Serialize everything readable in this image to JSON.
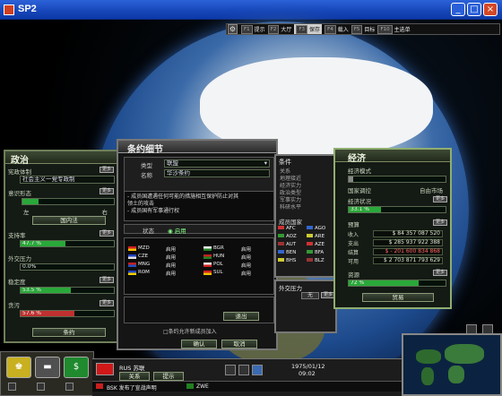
{
  "window": {
    "title": "SP2",
    "buttons": [
      "_",
      "□",
      "×"
    ]
  },
  "topbar": {
    "items": [
      {
        "key": "F1",
        "label": "提示"
      },
      {
        "key": "F2",
        "label": "大厅"
      },
      {
        "key": "F3",
        "label": "保存"
      },
      {
        "key": "F4",
        "label": "载入"
      },
      {
        "key": "F5",
        "label": "目标"
      },
      {
        "key": "F10",
        "label": "主选单"
      }
    ]
  },
  "politics": {
    "title": "政治",
    "system_label": "宪政体制",
    "system_value": "社会主义一党专政制",
    "ideology_label": "意识形态",
    "ideology_left": "左",
    "ideology_right": "右",
    "ideology_level": 0.18,
    "law_button": "国内法",
    "support_label": "支持率",
    "support_value": "47.7 %",
    "pressure_label": "外交压力",
    "pressure_value": "0.0%",
    "stability_label": "稳定度",
    "stability_value": "53.5 %",
    "corruption_label": "贪污",
    "corruption_value": "57.6 %",
    "treaty_button": "条约",
    "more": "更多"
  },
  "treaty": {
    "title": "条约细节",
    "type_label": "类型",
    "type_value": "联盟",
    "name_label": "名称",
    "name_value": "华沙条约",
    "conditions_label": "条件",
    "conditions": [
      "关系",
      "地理接近",
      "经济实力",
      "政治类型",
      "军事实力",
      "科研水平"
    ],
    "description": [
      "- 成员国遭遇任何可能的措施相互保护防止对其",
      "领土的攻击",
      "- 成员国有军事通行权"
    ],
    "status_label": "状态",
    "status_value": "启用",
    "members_label": "成员国家",
    "members": [
      {
        "code": "MZD",
        "status": "启用",
        "c1": "#d02020",
        "c2": "#f0c000"
      },
      {
        "code": "CZE",
        "status": "启用",
        "c1": "#2040c0",
        "c2": "#e0e0e0"
      },
      {
        "code": "MNG",
        "status": "启用",
        "c1": "#c02020",
        "c2": "#2050c0"
      },
      {
        "code": "ROM",
        "status": "启用",
        "c1": "#2040c0",
        "c2": "#f0d000"
      },
      {
        "code": "BGR",
        "status": "启用",
        "c1": "#f0f0f0",
        "c2": "#208020"
      },
      {
        "code": "HUN",
        "status": "启用",
        "c1": "#c02020",
        "c2": "#208020"
      },
      {
        "code": "POL",
        "status": "启用",
        "c1": "#f0f0f0",
        "c2": "#d02020"
      },
      {
        "code": "SUL",
        "status": "启用",
        "c1": "#d02020",
        "c2": "#f0c000"
      }
    ],
    "country_codes": [
      "AFC",
      "AGO",
      "AOZ",
      "ARE",
      "AUT",
      "AZE",
      "BEN",
      "BFA",
      "BHS",
      "BLZ"
    ],
    "exit_button": "退出",
    "allow_new": "□条约允许新成员加入",
    "ok_button": "确认",
    "cancel_button": "取消",
    "pressure_title": "外交压力",
    "pressure_value": "无",
    "more": "更多"
  },
  "economy": {
    "title": "经济",
    "model_label": "经济模式",
    "model_left": "国家调控",
    "model_right": "自由市场",
    "model_level": 0.05,
    "health_label": "经济状况",
    "health_value": "33.1 %",
    "budget_label": "预算",
    "income_label": "收入",
    "income_value": "$ 84 357 087 520",
    "expense_label": "支出",
    "expense_value": "$ 285 937 922 388",
    "balance_label": "结算",
    "balance_value": "$ - 201 600 834 868",
    "available_label": "可用",
    "available_value": "$ 2 703 871 793 629",
    "resources_label": "资源",
    "resources_value": "72 %",
    "trade_button": "贸易",
    "more": "更多"
  },
  "nation": {
    "code": "RUS",
    "name": "苏联",
    "sub_labels": [
      "关系",
      "提示"
    ],
    "date": "1975/01/12",
    "time": "09:02",
    "ticker": "BSK 发布了宣战声明",
    "ticker2": "ZWE"
  },
  "colors": {
    "support_fill": "#2aa83a",
    "pressure_fill": "#2aa83a",
    "stability_fill": "#2aa83a",
    "corruption_fill": "#c03030",
    "health_fill": "#2aa83a",
    "resources_fill": "#2aa83a",
    "balance_text": "#ff6060"
  }
}
